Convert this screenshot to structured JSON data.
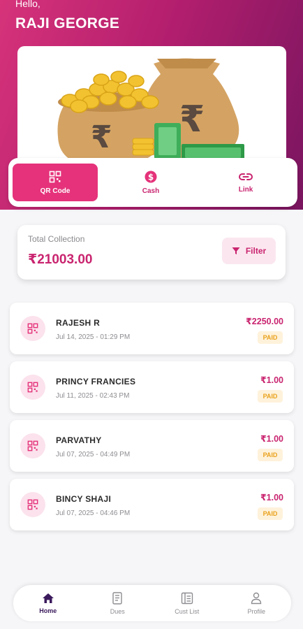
{
  "header": {
    "greeting": "Hello,",
    "user_name": "RAJI GEORGE"
  },
  "banner": {
    "rupee_symbol": "₹"
  },
  "payment_methods": [
    {
      "label": "QR Code",
      "icon": "qr-code-icon",
      "active": true
    },
    {
      "label": "Cash",
      "icon": "cash-icon",
      "active": false
    },
    {
      "label": "Link",
      "icon": "link-icon",
      "active": false
    }
  ],
  "collection": {
    "label": "Total Collection",
    "value": "₹21003.00",
    "filter_label": "Filter"
  },
  "transactions": [
    {
      "name": "RAJESH R",
      "date": "Jul 14, 2025 - 01:29 PM",
      "amount": "₹2250.00",
      "status": "PAID"
    },
    {
      "name": "PRINCY FRANCIES",
      "date": "Jul 11, 2025 - 02:43 PM",
      "amount": "₹1.00",
      "status": "PAID"
    },
    {
      "name": "PARVATHY",
      "date": "Jul 07, 2025 - 04:49 PM",
      "amount": "₹1.00",
      "status": "PAID"
    },
    {
      "name": "BINCY SHAJI",
      "date": "Jul 07, 2025 - 04:46 PM",
      "amount": "₹1.00",
      "status": "PAID"
    }
  ],
  "bottom_nav": [
    {
      "label": "Home",
      "icon": "home-icon",
      "active": true
    },
    {
      "label": "Dues",
      "icon": "dues-icon",
      "active": false
    },
    {
      "label": "Cust List",
      "icon": "cust-list-icon",
      "active": false
    },
    {
      "label": "Profile",
      "icon": "profile-icon",
      "active": false
    }
  ],
  "colors": {
    "primary": "#e5327a",
    "accent_text": "#c9246f",
    "status_paid": "#e9a21c",
    "hero_start": "#d6337a",
    "hero_end": "#7a1560"
  }
}
